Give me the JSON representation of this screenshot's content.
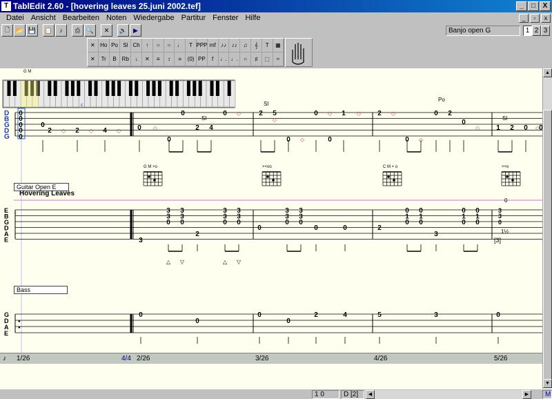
{
  "window": {
    "title": "TablEdit 2.60 - [hovering leaves 25.juni 2002.tef]",
    "min_label": "_",
    "max_label": "□",
    "close_label": "X"
  },
  "menu": [
    "Datei",
    "Ansicht",
    "Bearbeiten",
    "Noten",
    "Wiedergabe",
    "Partitur",
    "Fenster",
    "Hilfe"
  ],
  "mdi": {
    "min": "_",
    "restore": "▫",
    "close": "x"
  },
  "toolbar": [
    {
      "name": "new-icon",
      "glyph": "🗋"
    },
    {
      "name": "open-icon",
      "glyph": "📂"
    },
    {
      "name": "save-icon",
      "glyph": "💾"
    },
    {
      "name": "properties-icon",
      "glyph": "📋"
    },
    {
      "name": "midi-icon",
      "glyph": "♪"
    },
    {
      "name": "print-icon",
      "glyph": "⎙"
    },
    {
      "name": "preview-icon",
      "glyph": "🔍"
    },
    {
      "name": "delete-icon",
      "glyph": "✕"
    },
    {
      "name": "speaker-icon",
      "glyph": "🔈"
    },
    {
      "name": "play-icon",
      "glyph": "▶"
    }
  ],
  "tuning": "Banjo open G",
  "tracks": [
    "1",
    "2",
    "3"
  ],
  "palette": {
    "row1": [
      "✕",
      "Ho",
      "Po",
      "Sl",
      "Ch",
      "↑",
      "○",
      "○",
      "♩",
      "T",
      "PPP",
      "mf",
      "♪♪",
      "♪♪",
      "♫",
      "𝄞",
      "T",
      "▦"
    ],
    "row2": [
      "✕",
      "Tr",
      "B",
      "Rb",
      "↓",
      "✕",
      "≡",
      "↕",
      "⟡",
      "(0)",
      "PP",
      "f",
      "♩.",
      "♩.",
      "○",
      "♯",
      "⬚",
      "≈"
    ]
  },
  "piano": {
    "chord_label": "G M",
    "marker": "c"
  },
  "staves": {
    "banjo": {
      "strings": [
        "D",
        "B",
        "G",
        "D",
        "G"
      ]
    },
    "guitar": {
      "label": "Guitar Open E",
      "title": "Hovering Leaves",
      "strings": [
        "E",
        "B",
        "G",
        "D",
        "A",
        "E"
      ]
    },
    "bass": {
      "label": "Bass",
      "strings": [
        "G",
        "D",
        "A",
        "E"
      ]
    }
  },
  "chords": [
    {
      "name": "G M",
      "marks": "×o"
    },
    {
      "name": "",
      "marks": "××oo"
    },
    {
      "name": "C M",
      "marks": "×  o"
    },
    {
      "name": "",
      "marks": "××o"
    }
  ],
  "banjo_notes": {
    "measure1": {
      "d": "0",
      "b": "0",
      "g": "0",
      "dd": "0",
      "g5": "0",
      "n1": "0",
      "n2": "2",
      "n3": "4"
    },
    "measure2": [
      "0",
      "0",
      "0",
      "2",
      "4",
      "0",
      "2",
      "5",
      "0",
      "0",
      "1",
      "0",
      "2",
      "0",
      "0",
      "2",
      "0",
      "1",
      "2",
      "0",
      "0"
    ]
  },
  "annotations": {
    "sl": "Sl",
    "po": "Po"
  },
  "guitar_notes": {
    "pairs": [
      "3",
      "3",
      "3",
      "3",
      "3",
      "3",
      "0",
      "0",
      "0",
      "0",
      "0",
      "0",
      "1",
      "1",
      "1",
      "1",
      "0",
      "0",
      "0",
      "0"
    ],
    "singles": [
      "3",
      "2",
      "0",
      "0",
      "0",
      "2",
      "3",
      "[3]",
      "1½",
      "0"
    ]
  },
  "bass_notes": [
    "0",
    "0",
    "0",
    "0",
    "2",
    "4",
    "5",
    "3",
    "0"
  ],
  "timeline": {
    "t1": "1/26",
    "sig": "4/4",
    "t2": "2/26",
    "t3": "3/26",
    "t4": "4/26",
    "t5": "5/26"
  },
  "status": {
    "pos": "1 0",
    "track": "D [2]",
    "mode": "M"
  },
  "colors": {
    "title_start": "#000080",
    "title_end": "#1084d0",
    "paper": "#fffff0",
    "cursor": "#6090ff",
    "ghost_note": "#c04040"
  }
}
